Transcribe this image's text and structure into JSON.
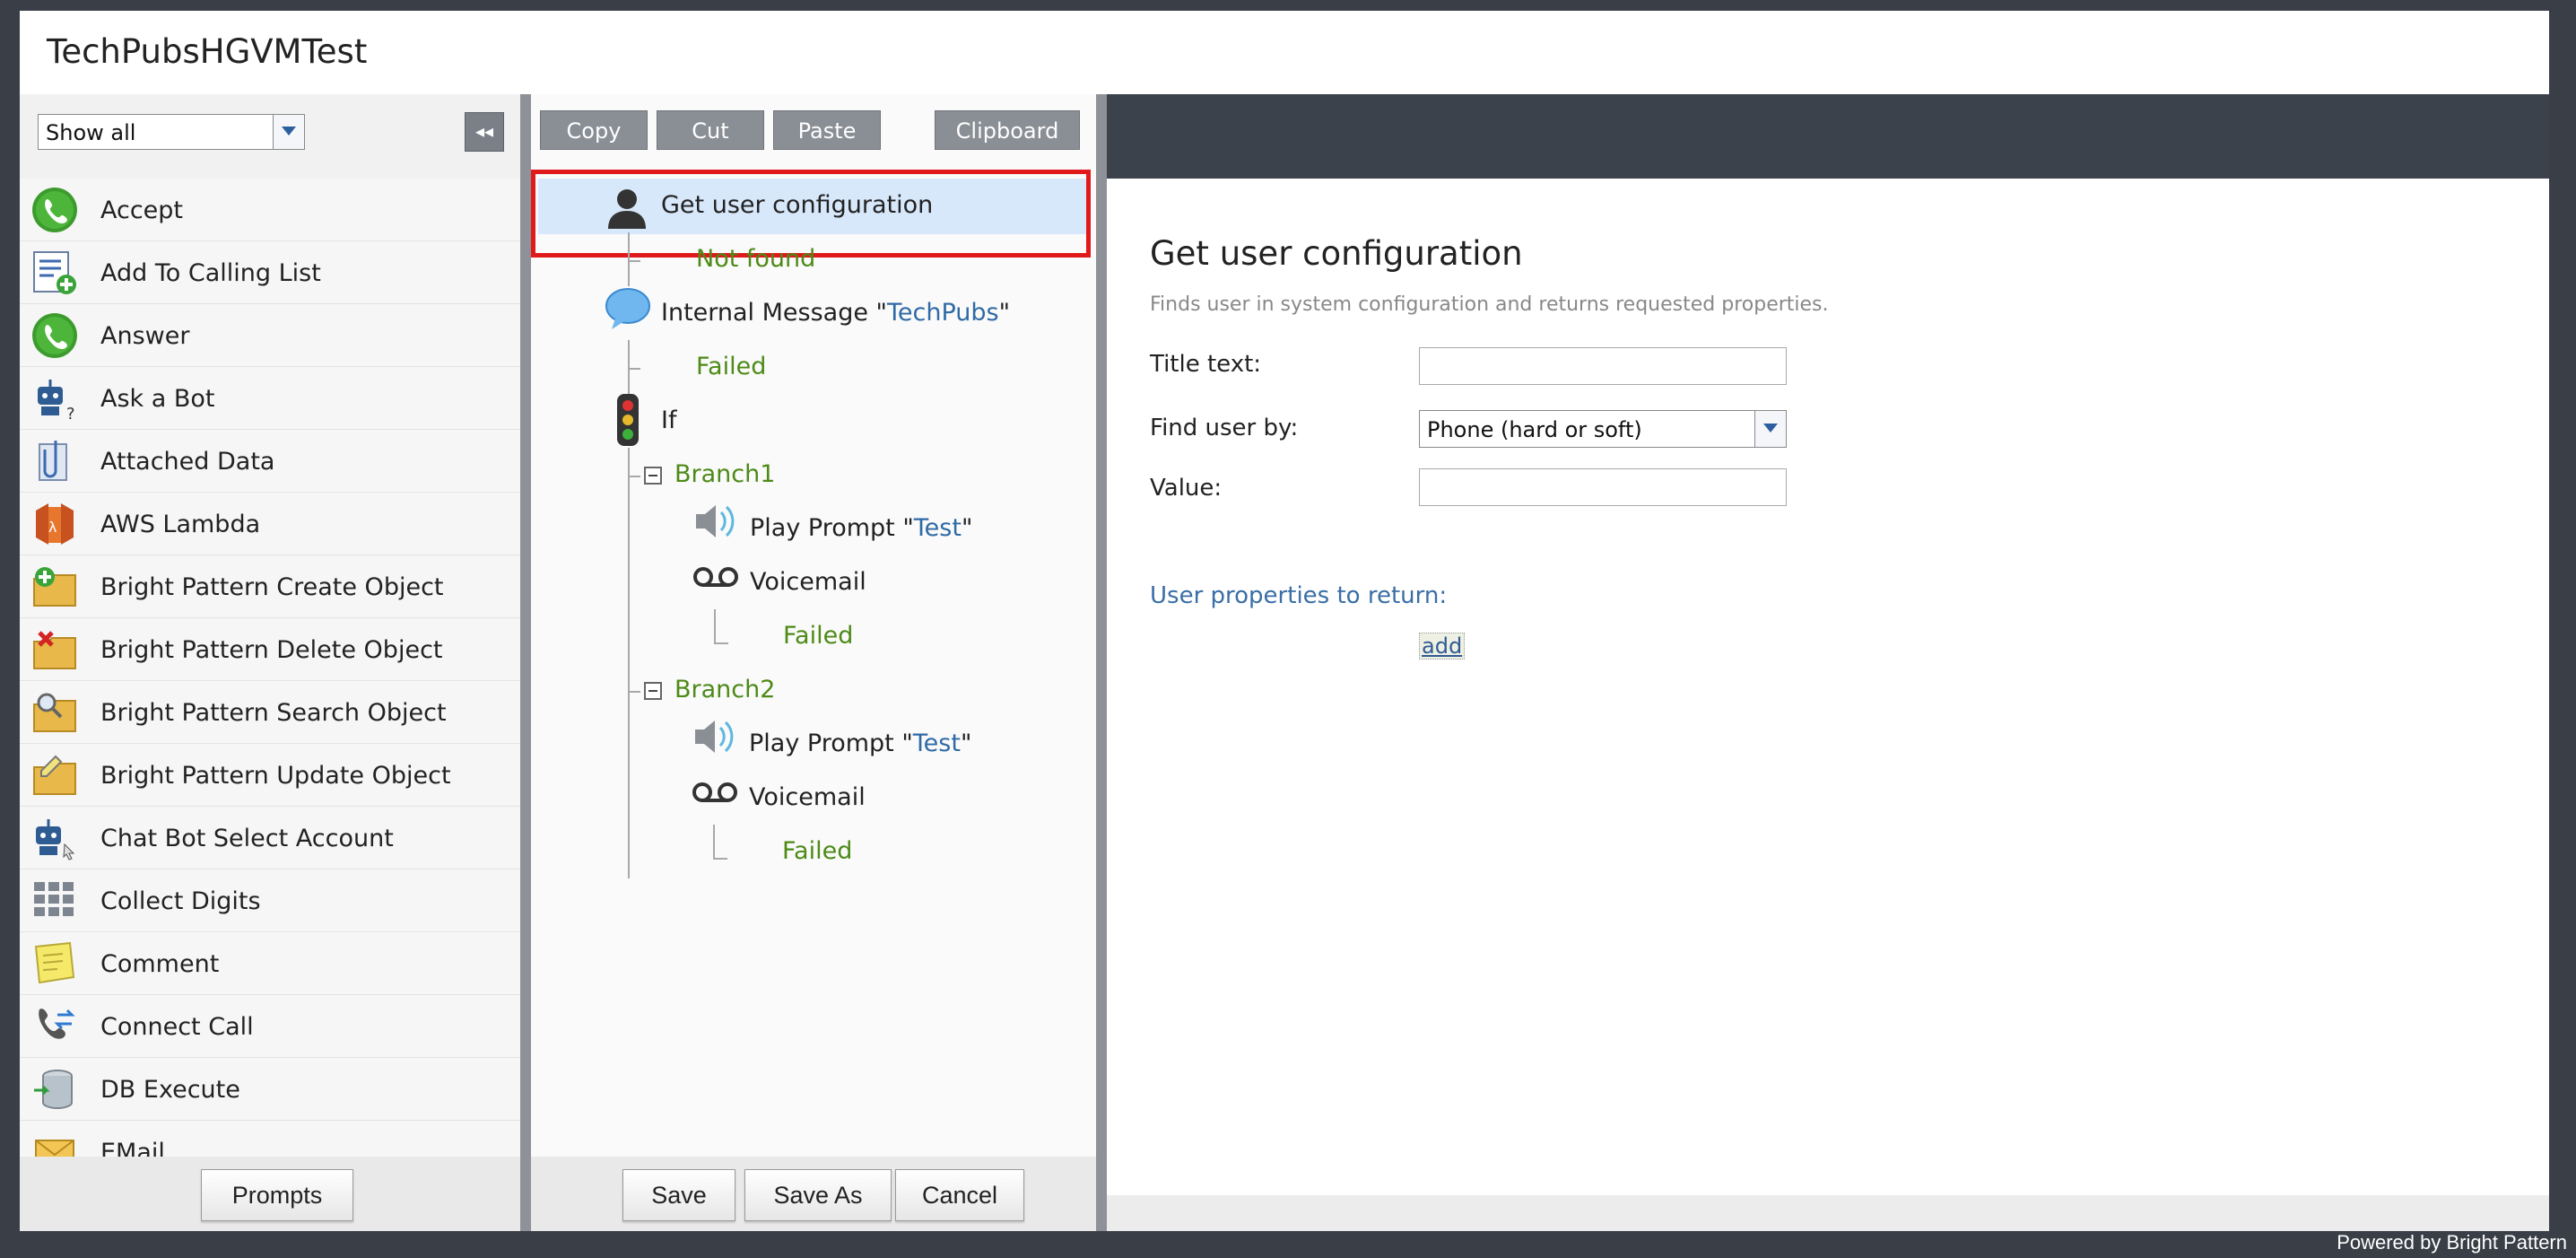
{
  "app": {
    "title": "TechPubsHGVMTest",
    "powered_by": "Powered by Bright Pattern"
  },
  "left_panel": {
    "filter_value": "Show all",
    "collapse_icon": "double-chevron-left-icon",
    "blocks": [
      {
        "label": "Accept",
        "icon": "phone-green-icon"
      },
      {
        "label": "Add To Calling List",
        "icon": "list-add-icon"
      },
      {
        "label": "Answer",
        "icon": "phone-green-icon"
      },
      {
        "label": "Ask a Bot",
        "icon": "robot-question-icon"
      },
      {
        "label": "Attached Data",
        "icon": "paperclip-icon"
      },
      {
        "label": "AWS Lambda",
        "icon": "aws-lambda-icon"
      },
      {
        "label": "Bright Pattern Create Object",
        "icon": "folder-plus-icon"
      },
      {
        "label": "Bright Pattern Delete Object",
        "icon": "folder-delete-icon"
      },
      {
        "label": "Bright Pattern Search Object",
        "icon": "folder-search-icon"
      },
      {
        "label": "Bright Pattern Update Object",
        "icon": "folder-edit-icon"
      },
      {
        "label": "Chat Bot Select Account",
        "icon": "robot-cursor-icon"
      },
      {
        "label": "Collect Digits",
        "icon": "keypad-icon"
      },
      {
        "label": "Comment",
        "icon": "note-icon"
      },
      {
        "label": "Connect Call",
        "icon": "connect-call-icon"
      },
      {
        "label": "DB Execute",
        "icon": "database-icon"
      },
      {
        "label": "EMail",
        "icon": "envelope-icon"
      }
    ],
    "prompts_button": "Prompts"
  },
  "toolbar": {
    "copy": "Copy",
    "cut": "Cut",
    "paste": "Paste",
    "clipboard": "Clipboard"
  },
  "tree": {
    "get_user_config": "Get user configuration",
    "not_found": "Not found",
    "internal_message_prefix": "Internal Message \"",
    "internal_message_arg": "TechPubs",
    "quote": "\"",
    "failed": "Failed",
    "if": "If",
    "branch1": "Branch1",
    "branch2": "Branch2",
    "play_prompt_prefix": "Play Prompt \"",
    "play_prompt_arg": "Test",
    "voicemail": "Voicemail"
  },
  "bottom_buttons": {
    "save": "Save",
    "save_as": "Save As",
    "cancel": "Cancel"
  },
  "properties": {
    "heading": "Get user configuration",
    "description": "Finds user in system configuration and returns requested properties.",
    "title_text_label": "Title text:",
    "title_text_value": "",
    "find_user_by_label": "Find user by:",
    "find_user_by_value": "Phone (hard or soft)",
    "value_label": "Value:",
    "value_value": "",
    "user_props_label": "User properties to return:",
    "add_link": "add"
  }
}
